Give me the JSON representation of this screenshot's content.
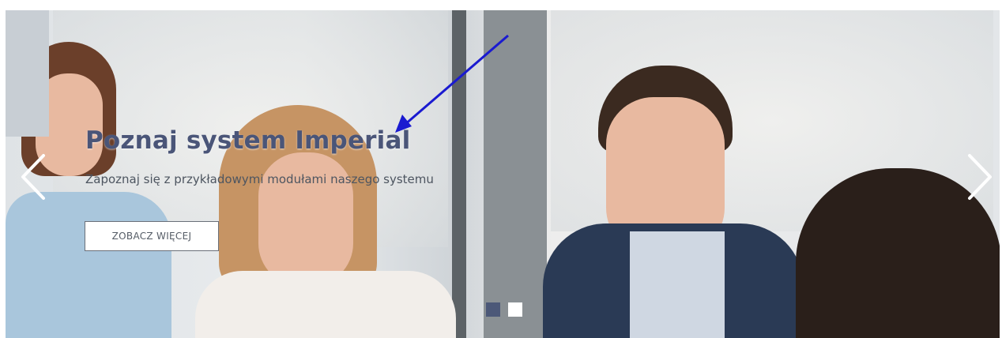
{
  "slide": {
    "title": "Poznaj system Imperial",
    "subtitle": "Zapoznaj się z przykładowymi modułami naszego systemu",
    "cta_label": "ZOBACZ WIĘCEJ"
  },
  "navigation": {
    "prev_icon": "chevron-left-icon",
    "next_icon": "chevron-right-icon"
  },
  "indicators": {
    "count": 2,
    "active_index": 0
  },
  "colors": {
    "title": "#4a5578",
    "active_dot": "#4c5878",
    "inactive_dot": "#ffffff",
    "annotation_arrow": "#1a1ad0"
  }
}
